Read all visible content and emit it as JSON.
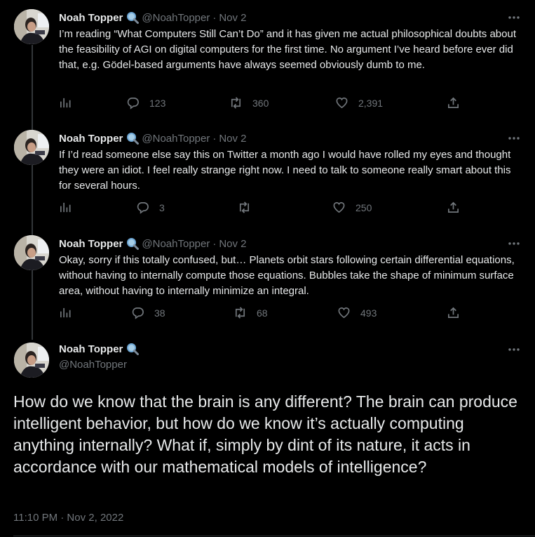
{
  "author": {
    "name": "Noah Topper",
    "handle": "@NoahTopper",
    "verified_icon": "magnifier-icon"
  },
  "separator": "·",
  "tweets": [
    {
      "date": "Nov 2",
      "text": "I’m reading “What Computers Still Can’t Do” and it has given me actual philosophical doubts about the feasibility of AGI on digital computers for the first time. No argument I’ve heard before ever did that, e.g. Gödel-based arguments have always seemed obviously dumb to me.",
      "replies": "123",
      "retweets": "360",
      "likes": "2,391"
    },
    {
      "date": "Nov 2",
      "text": "If I’d read someone else say this on Twitter a month ago I would have rolled my eyes and thought they were an idiot. I feel really strange right now. I need to talk to someone really smart about this for several hours.",
      "replies": "3",
      "retweets": "",
      "likes": "250"
    },
    {
      "date": "Nov 2",
      "text": "Okay, sorry if this totally confused, but… Planets orbit stars following certain differential equations, without having to internally compute those equations. Bubbles take the shape of minimum surface area, without having to internally minimize an integral.",
      "replies": "38",
      "retweets": "68",
      "likes": "493"
    }
  ],
  "main_tweet": {
    "text": "How do we know that the brain is any different? The brain can produce intelligent behavior, but how do we know it’s actually computing anything internally? What if, simply by dint of its nature, it acts in accordance with our mathematical models of intelligence?",
    "timestamp": "11:10 PM · Nov 2, 2022"
  },
  "colors": {
    "background": "#000000",
    "text": "#e7e9ea",
    "muted": "#71767b",
    "thread_line": "#333639"
  }
}
